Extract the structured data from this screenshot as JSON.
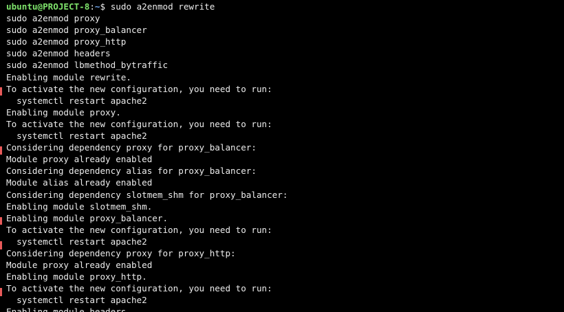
{
  "prompt": {
    "user_host": "ubuntu@PROJECT-8",
    "separator": ":",
    "path": "~",
    "symbol": "$",
    "command": " sudo a2enmod rewrite"
  },
  "lines": [
    "sudo a2enmod proxy",
    "sudo a2enmod proxy_balancer",
    "sudo a2enmod proxy_http",
    "sudo a2enmod headers",
    "sudo a2enmod lbmethod_bytraffic",
    "Enabling module rewrite.",
    "To activate the new configuration, you need to run:",
    "  systemctl restart apache2",
    "Enabling module proxy.",
    "To activate the new configuration, you need to run:",
    "  systemctl restart apache2",
    "Considering dependency proxy for proxy_balancer:",
    "Module proxy already enabled",
    "Considering dependency alias for proxy_balancer:",
    "Module alias already enabled",
    "Considering dependency slotmem_shm for proxy_balancer:",
    "Enabling module slotmem_shm.",
    "Enabling module proxy_balancer.",
    "To activate the new configuration, you need to run:",
    "  systemctl restart apache2",
    "Considering dependency proxy for proxy_http:",
    "Module proxy already enabled",
    "Enabling module proxy_http.",
    "To activate the new configuration, you need to run:",
    "  systemctl restart apache2",
    "Enabling module headers."
  ],
  "colors": {
    "background": "#000000",
    "text": "#ececec",
    "prompt_user": "#7ee36b",
    "prompt_path": "#6fa7f0",
    "edge_marker": "#e85a5a"
  }
}
